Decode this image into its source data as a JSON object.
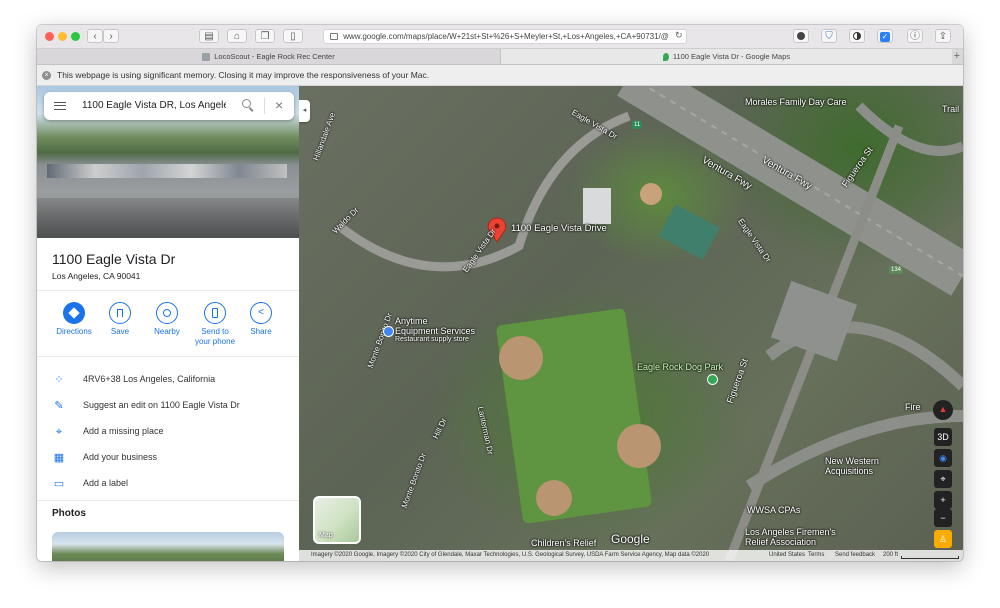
{
  "browser": {
    "url": "www.google.com/maps/place/W+21st+St+%26+S+Meyler+St,+Los+Angeles,+CA+90731/@",
    "tabs": [
      {
        "label": "LocoScout - Eagle Rock Rec Center",
        "active": false
      },
      {
        "label": "1100 Eagle Vista Dr - Google Maps",
        "active": true
      }
    ],
    "banner": "This webpage is using significant memory. Closing it may improve the responsiveness of your Mac."
  },
  "search": {
    "value": "1100 Eagle Vista DR, Los Angeles"
  },
  "place": {
    "title": "1100 Eagle Vista Dr",
    "address": "Los Angeles, CA 90041"
  },
  "actions": [
    {
      "label": "Directions"
    },
    {
      "label": "Save"
    },
    {
      "label": "Nearby"
    },
    {
      "label": "Send to your phone"
    },
    {
      "label": "Share"
    }
  ],
  "details": [
    {
      "text": "4RV6+38 Los Angeles, California",
      "icon": "plus-code-icon"
    },
    {
      "text": "Suggest an edit on 1100 Eagle Vista Dr",
      "icon": "pencil-icon"
    },
    {
      "text": "Add a missing place",
      "icon": "add-place-icon"
    },
    {
      "text": "Add your business",
      "icon": "business-icon"
    },
    {
      "text": "Add a label",
      "icon": "label-icon"
    }
  ],
  "photos_heading": "Photos",
  "map": {
    "pin_label": "1100 Eagle Vista Drive",
    "labels": {
      "morales": "Morales Family Day Care",
      "ventura1": "Ventura Fwy",
      "ventura2": "Ventura Fwy",
      "figueroa1": "Figueroa St",
      "figueroa2": "Figueroa St",
      "eagle_vista1": "Eagle Vista Dr",
      "eagle_vista2": "Eagle Vista Dr",
      "eagle_vista3": "Eagle Vista Dr",
      "hillandale": "Hillandale Ave",
      "waldo": "Waldo Dr",
      "hill": "Hill Dr",
      "monte_bonito1": "Monte Bonito Dr",
      "monte_bonito2": "Monte Bonito Dr",
      "lanterman": "Lanterman Dr",
      "anytime1": "Anytime",
      "anytime2": "Equipment Services",
      "anytime3": "Restaurant supply store",
      "dog_park": "Eagle Rock Dog Park",
      "new_western1": "New Western",
      "new_western2": "Acquisitions",
      "wwsa": "WWSA CPAs",
      "firemen1": "Los Angeles Firemen's",
      "firemen2": "Relief Association",
      "childrens": "Children's Relief",
      "fire": "Fire",
      "trail": "Trail",
      "google": "Google",
      "hwy134": "134",
      "hwy11": "11"
    },
    "layer_toggle_label": "Map",
    "controls": {
      "three_d": "3D",
      "zoom_in": "+",
      "zoom_out": "−"
    },
    "footer": {
      "imagery": "Imagery ©2020 Google, Imagery ©2020 City of Glendale, Maxar Technologies, U.S. Geological Survey, USDA Farm Service Agency, Map data ©2020",
      "region": "United States",
      "terms": "Terms",
      "feedback": "Send feedback",
      "scale": "200 ft"
    }
  }
}
